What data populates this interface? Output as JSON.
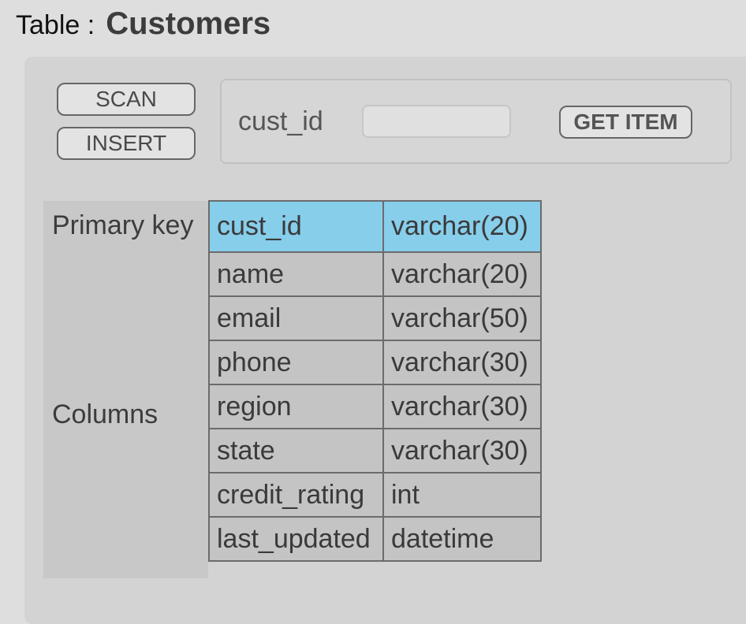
{
  "header": {
    "prefix": "Table :",
    "table_name": "Customers"
  },
  "actions": {
    "scan_label": "SCAN",
    "insert_label": "INSERT"
  },
  "get_item": {
    "key_label": "cust_id",
    "input_value": "",
    "button_label": "GET ITEM"
  },
  "schema": {
    "primary_key_label": "Primary key",
    "columns_label": "Columns",
    "primary_key": {
      "name": "cust_id",
      "type": "varchar(20)"
    },
    "columns": [
      {
        "name": "name",
        "type": "varchar(20)"
      },
      {
        "name": "email",
        "type": "varchar(50)"
      },
      {
        "name": "phone",
        "type": "varchar(30)"
      },
      {
        "name": "region",
        "type": "varchar(30)"
      },
      {
        "name": "state",
        "type": "varchar(30)"
      },
      {
        "name": "credit_rating",
        "type": "int"
      },
      {
        "name": "last_updated",
        "type": "datetime"
      }
    ]
  },
  "colors": {
    "primary_key_highlight": "#87ceeb",
    "background": "#dedede",
    "panel": "#d3d3d3"
  }
}
